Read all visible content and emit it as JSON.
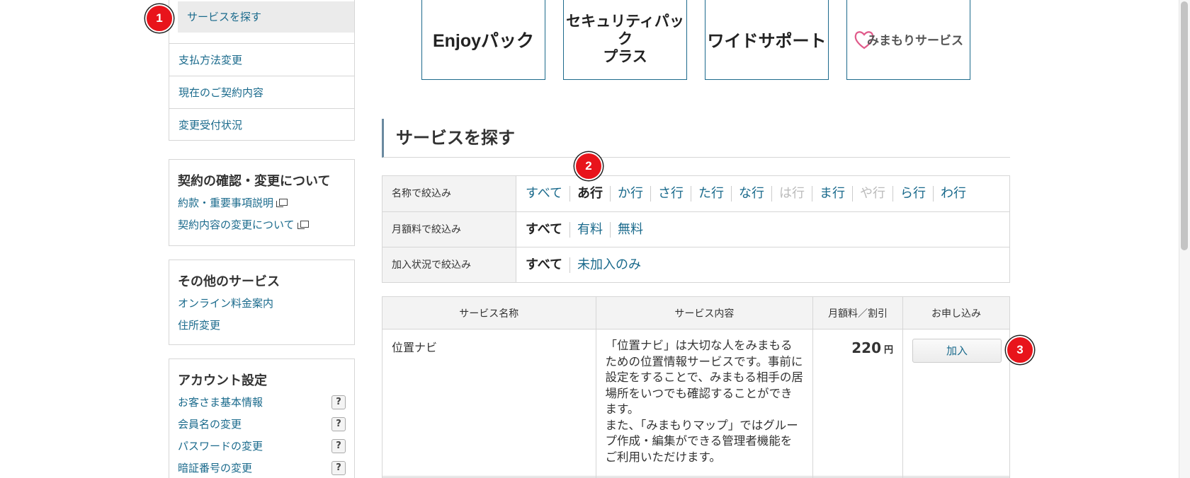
{
  "sidebar": {
    "nav": [
      {
        "label": "サービスを探す",
        "active": true
      },
      {
        "label": "支払方法変更"
      },
      {
        "label": "現在のご契約内容"
      },
      {
        "label": "変更受付状況"
      }
    ],
    "contract": {
      "heading": "契約の確認・変更について",
      "links": [
        {
          "label": "約款・重要事項説明"
        },
        {
          "label": "契約内容の変更について"
        }
      ]
    },
    "other": {
      "heading": "その他のサービス",
      "links": [
        {
          "label": "オンライン料金案内"
        },
        {
          "label": "住所変更"
        }
      ]
    },
    "account": {
      "heading": "アカウント設定",
      "help_glyph": "?",
      "links": [
        {
          "label": "お客さま基本情報"
        },
        {
          "label": "会員名の変更"
        },
        {
          "label": "パスワードの変更"
        },
        {
          "label": "暗証番号の変更"
        }
      ]
    }
  },
  "banners": [
    {
      "label": "Enjoyパック"
    },
    {
      "label": "セキュリティパック\nプラス"
    },
    {
      "label": "ワイドサポート"
    },
    {
      "label": "みまもりサービス",
      "icon": "heart-icon"
    }
  ],
  "section_title": "サービスを探す",
  "filters": [
    {
      "label": "名称で絞込み",
      "options": [
        "すべて",
        "あ行",
        "か行",
        "さ行",
        "た行",
        "な行",
        "は行",
        "ま行",
        "や行",
        "ら行",
        "わ行"
      ],
      "selected": "あ行",
      "disabled": [
        "は行",
        "や行"
      ]
    },
    {
      "label": "月額料で絞込み",
      "options": [
        "すべて",
        "有料",
        "無料"
      ],
      "selected": "すべて",
      "disabled": []
    },
    {
      "label": "加入状況で絞込み",
      "options": [
        "すべて",
        "未加入のみ"
      ],
      "selected": "すべて",
      "disabled": []
    }
  ],
  "table": {
    "headers": [
      "サービス名称",
      "サービス内容",
      "月額料／割引",
      "お申し込み"
    ],
    "rows": [
      {
        "name": "位置ナビ",
        "description": "「位置ナビ」は大切な人をみまもるための位置情報サービスです。事前に設定をすることで、みまもる相手の居場所をいつでも確認することができます。\nまた、「みまもりマップ」ではグループ作成・編集ができる管理者機能をご利用いただけます。",
        "price": "220",
        "price_unit": "円",
        "action": "加入"
      }
    ]
  },
  "markers": [
    "1",
    "2",
    "3"
  ],
  "colors": {
    "link": "#1a6a8c",
    "marker": "#e8141b",
    "banner_border": "#1d6a8c",
    "heart": "#e05a8a"
  }
}
